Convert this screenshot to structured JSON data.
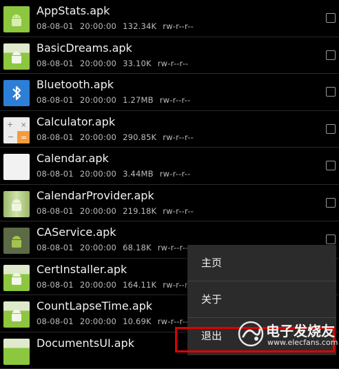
{
  "files": [
    {
      "name": "AppStats.apk",
      "date": "08-08-01",
      "time": "20:00:00",
      "size": "132.34K",
      "perm": "rw-r--r--",
      "icon": "android-icon"
    },
    {
      "name": "BasicDreams.apk",
      "date": "08-08-01",
      "time": "20:00:00",
      "size": "33.10K",
      "perm": "rw-r--r--",
      "icon": "android-icon"
    },
    {
      "name": "Bluetooth.apk",
      "date": "08-08-01",
      "time": "20:00:00",
      "size": "1.27MB",
      "perm": "rw-r--r--",
      "icon": "bluetooth-icon"
    },
    {
      "name": "Calculator.apk",
      "date": "08-08-01",
      "time": "20:00:00",
      "size": "290.85K",
      "perm": "rw-r--r--",
      "icon": "calculator-icon"
    },
    {
      "name": "Calendar.apk",
      "date": "08-08-01",
      "time": "20:00:00",
      "size": "3.44MB",
      "perm": "rw-r--r--",
      "icon": "calendar-icon"
    },
    {
      "name": "CalendarProvider.apk",
      "date": "08-08-01",
      "time": "20:00:00",
      "size": "219.18K",
      "perm": "rw-r--r--",
      "icon": "android-icon"
    },
    {
      "name": "CAService.apk",
      "date": "08-08-01",
      "time": "20:00:00",
      "size": "68.18K",
      "perm": "rw-r--r--",
      "icon": "android-icon"
    },
    {
      "name": "CertInstaller.apk",
      "date": "08-08-01",
      "time": "20:00:00",
      "size": "164.11K",
      "perm": "rw-r--r--",
      "icon": "android-icon"
    },
    {
      "name": "CountLapseTime.apk",
      "date": "08-08-01",
      "time": "20:00:00",
      "size": "10.69K",
      "perm": "rw-r--r--",
      "icon": "android-icon"
    },
    {
      "name": "DocumentsUI.apk",
      "date": "",
      "time": "",
      "size": "",
      "perm": "",
      "icon": "android-icon"
    }
  ],
  "menu": {
    "items": [
      {
        "label": "主页"
      },
      {
        "label": "关于"
      },
      {
        "label": "退出"
      }
    ]
  },
  "watermark": {
    "title": "电子发烧友",
    "url": "www.elecfans.com"
  },
  "colors": {
    "background": "#000000",
    "menu_bg": "#2b2b2b",
    "highlight": "#e00000",
    "android_green": "#8dc63f",
    "bluetooth_blue": "#2d7ed6",
    "calc_orange": "#f39c3d"
  }
}
